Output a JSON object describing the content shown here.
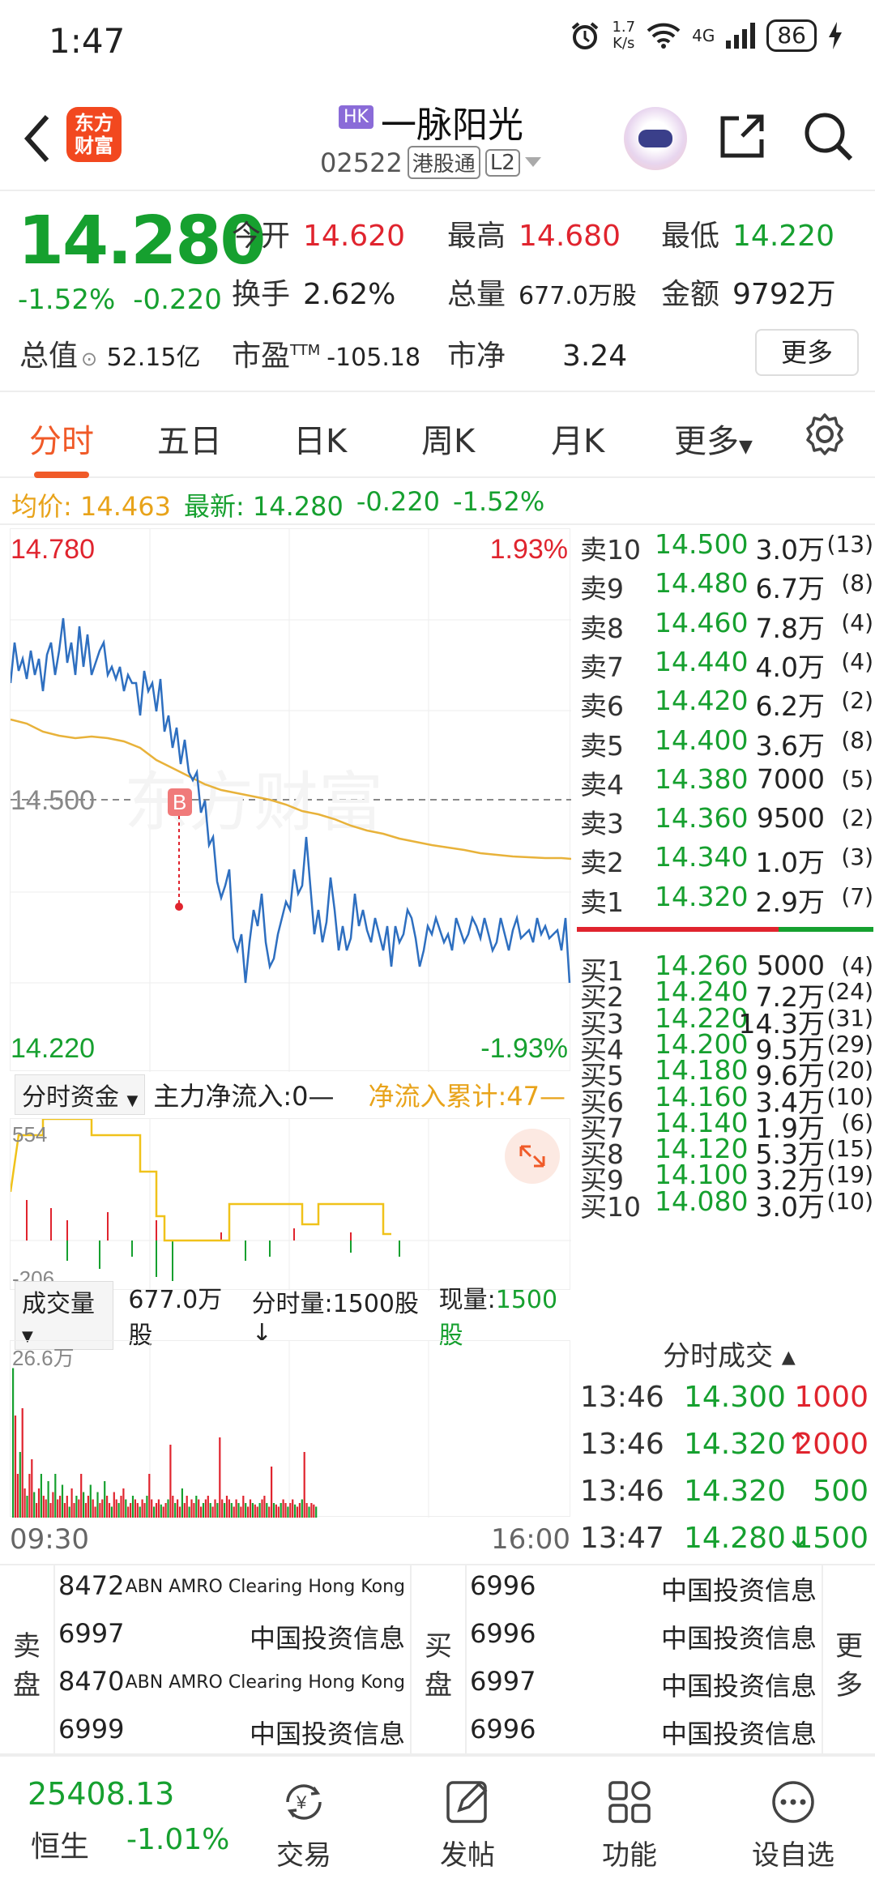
{
  "status": {
    "time": "1:47",
    "net_speed_top": "1.7",
    "net_speed_bottom": "K/s",
    "signal": "4G",
    "battery": "86"
  },
  "header": {
    "logo_line1": "东方",
    "logo_line2": "财富",
    "market_tag": "HK",
    "stock_name": "一脉阳光",
    "stock_code": "02522",
    "connect_tag": "港股通",
    "level_tag": "L2"
  },
  "quote": {
    "price": "14.280",
    "pct_change": "-1.52%",
    "abs_change": "-0.220",
    "rows": [
      [
        {
          "label": "今开",
          "value": "14.620",
          "color": "red"
        },
        {
          "label": "最高",
          "value": "14.680",
          "color": "red"
        },
        {
          "label": "最低",
          "value": "14.220",
          "color": "green"
        }
      ],
      [
        {
          "label": "换手",
          "value": "2.62%",
          "color": "black"
        },
        {
          "label": "总量",
          "value": "677.0万股",
          "color": "black"
        },
        {
          "label": "金额",
          "value": "9792万",
          "color": "black"
        }
      ],
      [
        {
          "label": "总值",
          "value": "52.15亿",
          "color": "black"
        },
        {
          "label": "市盈",
          "sup": "TTM",
          "value": "-105.18",
          "color": "black"
        },
        {
          "label": "市净",
          "value": "3.24",
          "color": "black"
        }
      ]
    ],
    "more_label": "更多"
  },
  "tabs": [
    "分时",
    "五日",
    "日K",
    "周K",
    "月K",
    "更多"
  ],
  "avg_bar": {
    "avg_label": "均价:",
    "avg_value": "14.463",
    "latest_label": "最新:",
    "latest_value": "14.280",
    "change": "-0.220",
    "pct": "-1.52%"
  },
  "intraday": {
    "high_label": "14.780",
    "low_label": "14.220",
    "mid_label": "14.500",
    "high_pct": "1.93%",
    "low_pct": "-1.93%",
    "watermark": "东方财富",
    "marker": "B"
  },
  "order_book": {
    "asks": [
      [
        "卖10",
        "14.500",
        "3.0万",
        "(13)"
      ],
      [
        "卖9",
        "14.480",
        "6.7万",
        "(8)"
      ],
      [
        "卖8",
        "14.460",
        "7.8万",
        "(4)"
      ],
      [
        "卖7",
        "14.440",
        "4.0万",
        "(4)"
      ],
      [
        "卖6",
        "14.420",
        "6.2万",
        "(2)"
      ],
      [
        "卖5",
        "14.400",
        "3.6万",
        "(8)"
      ],
      [
        "卖4",
        "14.380",
        "7000",
        "(5)"
      ],
      [
        "卖3",
        "14.360",
        "9500",
        "(2)"
      ],
      [
        "卖2",
        "14.340",
        "1.0万",
        "(3)"
      ],
      [
        "卖1",
        "14.320",
        "2.9万",
        "(7)"
      ]
    ],
    "bids": [
      [
        "买1",
        "14.260",
        "5000",
        "(4)"
      ],
      [
        "买2",
        "14.240",
        "7.2万",
        "(24)"
      ],
      [
        "买3",
        "14.220",
        "14.3万",
        "(31)"
      ],
      [
        "买4",
        "14.200",
        "9.5万",
        "(29)"
      ],
      [
        "买5",
        "14.180",
        "9.6万",
        "(20)"
      ],
      [
        "买6",
        "14.160",
        "3.4万",
        "(10)"
      ],
      [
        "买7",
        "14.140",
        "1.9万",
        "(6)"
      ],
      [
        "买8",
        "14.120",
        "5.3万",
        "(15)"
      ],
      [
        "买9",
        "14.100",
        "3.2万",
        "(19)"
      ],
      [
        "买10",
        "14.080",
        "3.0万",
        "(10)"
      ]
    ]
  },
  "ticks": {
    "title": "分时成交 ▴",
    "rows": [
      [
        "13:46",
        "14.300",
        "",
        "1000",
        "red"
      ],
      [
        "13:46",
        "14.320",
        "↑",
        "2000",
        "red"
      ],
      [
        "13:46",
        "14.320",
        "",
        "500",
        "green"
      ],
      [
        "13:47",
        "14.280",
        "↓",
        "1500",
        "green"
      ]
    ]
  },
  "flow": {
    "selector": "分时资金",
    "main_label": "主力净流入:0—",
    "cum_label": "净流入累计:47—",
    "top": "554",
    "bottom": "-206"
  },
  "volume": {
    "selector": "成交量",
    "total": "677.0万股",
    "per_label": "分时量:1500股↓",
    "now_label": "现量:",
    "now_value": "1500股",
    "max": "26.6万",
    "start": "09:30",
    "end": "16:00"
  },
  "broker": {
    "sell_label": "卖盘",
    "buy_label": "买盘",
    "more": "更多",
    "sell": [
      [
        "8472",
        "ABN AMRO Clearing Hong Kong",
        true
      ],
      [
        "6997",
        "中国投资信息",
        false
      ],
      [
        "8470",
        "ABN AMRO Clearing Hong Kong",
        true
      ],
      [
        "6999",
        "中国投资信息",
        false
      ]
    ],
    "buy": [
      [
        "6996",
        "中国投资信息"
      ],
      [
        "6996",
        "中国投资信息"
      ],
      [
        "6997",
        "中国投资信息"
      ],
      [
        "6996",
        "中国投资信息"
      ]
    ]
  },
  "nav": {
    "index_value": "25408.13",
    "index_name": "恒生",
    "index_change": "-1.01%",
    "items": [
      "交易",
      "发帖",
      "功能",
      "设自选"
    ]
  }
}
